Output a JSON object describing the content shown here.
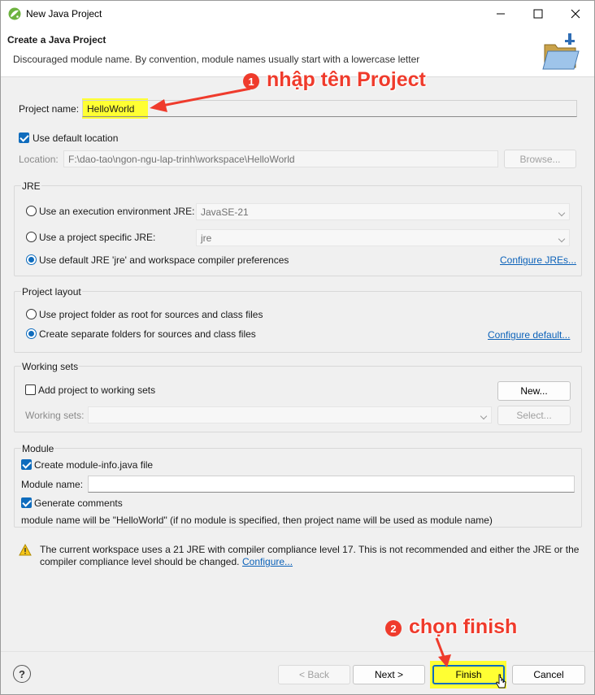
{
  "window": {
    "title": "New Java Project"
  },
  "header": {
    "title": "Create a Java Project",
    "message": "Discouraged module name. By convention, module names usually start with a lowercase letter"
  },
  "project": {
    "name_label": "Project name:",
    "name_value": "HelloWorld",
    "use_default_location_label": "Use default location",
    "use_default_location_checked": true,
    "location_label": "Location:",
    "location_value": "F:\\dao-tao\\ngon-ngu-lap-trinh\\workspace\\HelloWorld",
    "browse_label": "Browse..."
  },
  "jre": {
    "group_title": "JRE",
    "option_env_label": "Use an execution environment JRE:",
    "option_env_value": "JavaSE-21",
    "option_specific_label": "Use a project specific JRE:",
    "option_specific_value": "jre",
    "option_default_label": "Use default JRE 'jre' and workspace compiler preferences",
    "selected": "default",
    "configure_link": "Configure JREs..."
  },
  "layout": {
    "group_title": "Project layout",
    "option_root_label": "Use project folder as root for sources and class files",
    "option_separate_label": "Create separate folders for sources and class files",
    "selected": "separate",
    "configure_link": "Configure default..."
  },
  "working_sets": {
    "group_title": "Working sets",
    "add_label": "Add project to working sets",
    "add_checked": false,
    "new_button": "New...",
    "sets_label": "Working sets:",
    "select_button": "Select..."
  },
  "module": {
    "group_title": "Module",
    "create_label": "Create module-info.java file",
    "create_checked": true,
    "name_label": "Module name:",
    "name_value": "",
    "generate_label": "Generate comments",
    "generate_checked": true,
    "info_text": "module name will be \"HelloWorld\"  (if no module is specified, then project name will be used as module name)"
  },
  "warning": {
    "line1": "The current workspace uses a 21 JRE with compiler compliance level 17. This is not recommended and either the JRE or the",
    "line2": "compiler compliance level should be changed.",
    "configure_link": "Configure..."
  },
  "footer": {
    "help_icon": "?",
    "back_label": "< Back",
    "next_label": "Next >",
    "finish_label": "Finish",
    "cancel_label": "Cancel"
  },
  "annotations": {
    "step1_number": "1",
    "step1_text": "nhập tên Project",
    "step2_number": "2",
    "step2_text": "chọn finish"
  },
  "colors": {
    "accent": "#0f6cbd",
    "link": "#0c62b9",
    "highlight": "#ffff33",
    "annotation": "#ef3b2c"
  }
}
